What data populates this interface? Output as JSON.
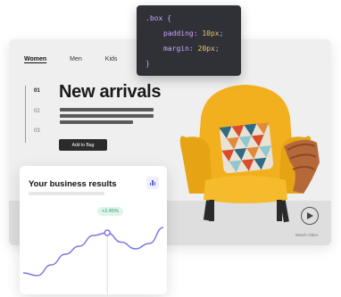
{
  "nav": {
    "tabs": [
      {
        "label": "Women",
        "active": true
      },
      {
        "label": "Men",
        "active": false
      },
      {
        "label": "Kids",
        "active": false
      }
    ]
  },
  "slider": {
    "numbers": [
      "01",
      "02",
      "03"
    ],
    "active_index": 0
  },
  "hero": {
    "heading": "New arrivals",
    "button_label": "Add to Bag"
  },
  "video": {
    "label": "Watch Video"
  },
  "code": {
    "selector": ".box {",
    "prop1": "padding:",
    "val1": "10px",
    "prop2": "margin:",
    "val2": "20px",
    "close": "}"
  },
  "card": {
    "title": "Your business results",
    "badge": "+2.45%",
    "line_color": "#7b78e0"
  },
  "colors": {
    "chair": "#f2b01e",
    "accent": "#5a5fd8",
    "badge_bg": "#dff4ea"
  },
  "chart_data": {
    "type": "line",
    "x": [
      0,
      1,
      2,
      3,
      4,
      5,
      6,
      7,
      8,
      9,
      10
    ],
    "values": [
      10,
      8,
      16,
      24,
      30,
      38,
      40,
      33,
      28,
      32,
      44
    ],
    "highlight_index": 6,
    "ylim": [
      0,
      50
    ]
  }
}
